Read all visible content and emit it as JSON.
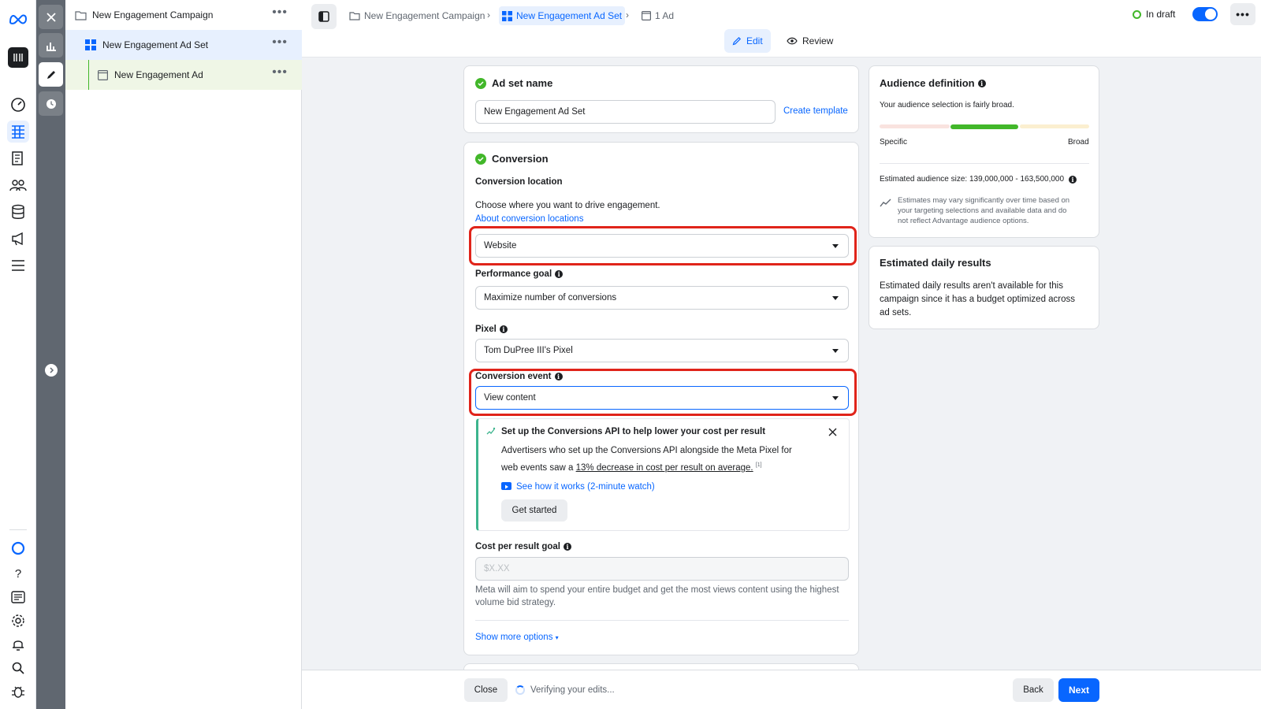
{
  "tree": {
    "campaign": "New Engagement Campaign",
    "adset": "New Engagement Ad Set",
    "ad": "New Engagement Ad"
  },
  "topbar": {
    "breadcrumb_campaign": "New Engagement Campaign",
    "breadcrumb_adset": "New Engagement Ad Set",
    "breadcrumb_ad": "1 Ad",
    "status": "In draft",
    "tab_edit": "Edit",
    "tab_review": "Review"
  },
  "adset_name_card": {
    "title": "Ad set name",
    "value": "New Engagement Ad Set",
    "create_template": "Create template"
  },
  "conversion_card": {
    "title": "Conversion",
    "location_label": "Conversion location",
    "location_help": "Choose where you want to drive engagement.",
    "location_link": "About conversion locations",
    "location_value": "Website",
    "performance_goal_label": "Performance goal",
    "performance_goal_value": "Maximize number of conversions",
    "pixel_label": "Pixel",
    "pixel_value": "Tom DuPree III's Pixel",
    "event_label": "Conversion event",
    "event_value": "View content",
    "capi": {
      "title": "Set up the Conversions API to help lower your cost per result",
      "body_line1": "Advertisers who set up the Conversions API alongside the Meta Pixel for",
      "body_line2_prefix": "web events saw a ",
      "body_link": "13% decrease in cost per result on average.",
      "footnote": "[1]",
      "video_link": "See how it works (2-minute watch)",
      "get_started": "Get started"
    },
    "cost_goal_label": "Cost per result goal",
    "cost_goal_placeholder": "$X.XX",
    "cost_goal_help_line1": "Meta will aim to spend your entire budget and get the most views content using the highest",
    "cost_goal_help_line2": "volume bid strategy.",
    "show_more": "Show more options"
  },
  "audience_card": {
    "title": "Audience definition",
    "summary": "Your audience selection is fairly broad.",
    "specific": "Specific",
    "broad": "Broad",
    "size": "Estimated audience size: 139,000,000 - 163,500,000",
    "note_line1": "Estimates may vary significantly over time based on",
    "note_line2": "your targeting selections and available data and do",
    "note_line3": "not reflect Advantage audience options."
  },
  "daily_card": {
    "title": "Estimated daily results",
    "line1": "Estimated daily results aren't available for this",
    "line2": "campaign since it has a budget optimized across",
    "line3": "ad sets."
  },
  "footer": {
    "close": "Close",
    "status": "Verifying your edits...",
    "back": "Back",
    "next": "Next"
  },
  "colors": {
    "accent": "#0866ff",
    "success": "#42b72a",
    "highlight": "#e0241a"
  }
}
